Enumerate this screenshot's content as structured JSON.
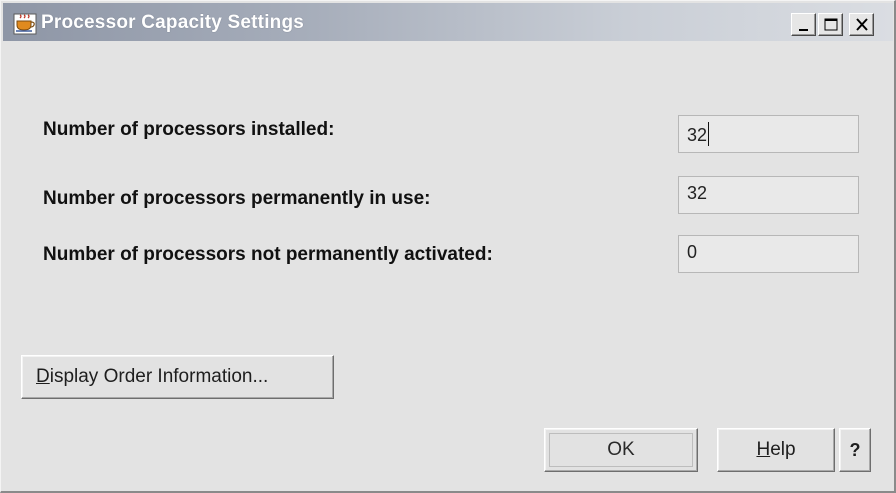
{
  "window": {
    "title": "Processor Capacity Settings",
    "controls": {
      "minimize_icon": "minimize-icon",
      "maximize_icon": "maximize-icon",
      "close_icon": "close-icon"
    }
  },
  "fields": [
    {
      "label": "Number of processors installed:",
      "value": "32"
    },
    {
      "label": "Number of processors permanently in use:",
      "value": "32"
    },
    {
      "label": "Number of processors not permanently activated:",
      "value": "0"
    }
  ],
  "buttons": {
    "display_order": {
      "mnemonic": "D",
      "rest": "isplay Order Information..."
    },
    "ok": "OK",
    "help": {
      "mnemonic": "H",
      "rest": "elp"
    },
    "question": "?"
  },
  "colors": {
    "window_bg": "#e3e3e3",
    "titlebar_start": "#8e96a6",
    "titlebar_end": "#dadde2",
    "title_text": "#ffffff"
  }
}
